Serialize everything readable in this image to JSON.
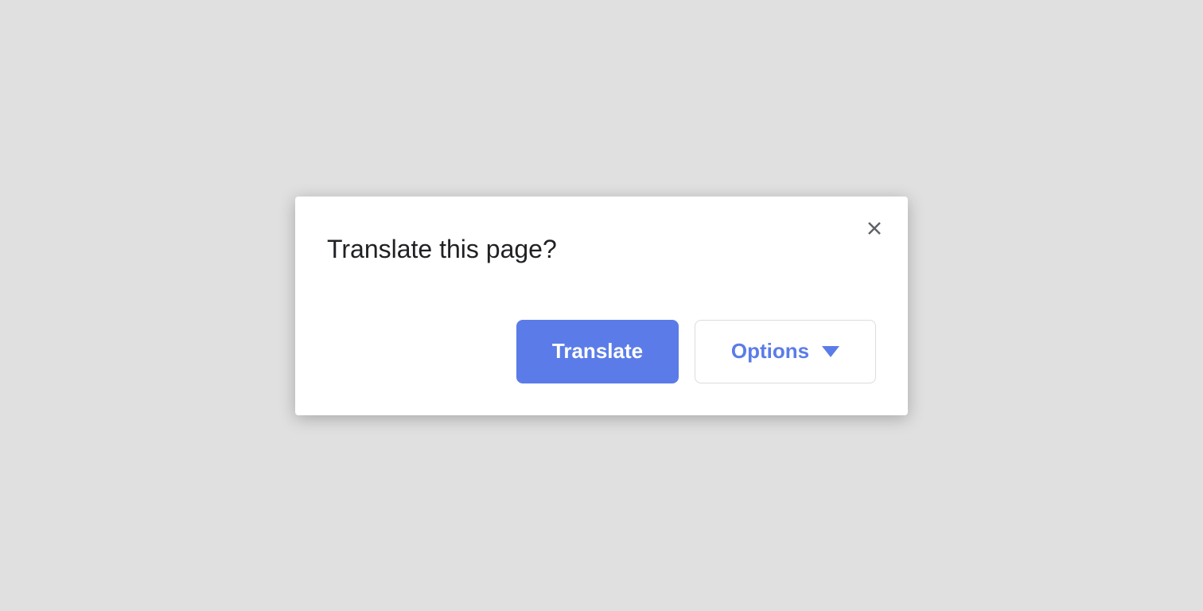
{
  "dialog": {
    "title": "Translate this page?",
    "translate_label": "Translate",
    "options_label": "Options"
  }
}
